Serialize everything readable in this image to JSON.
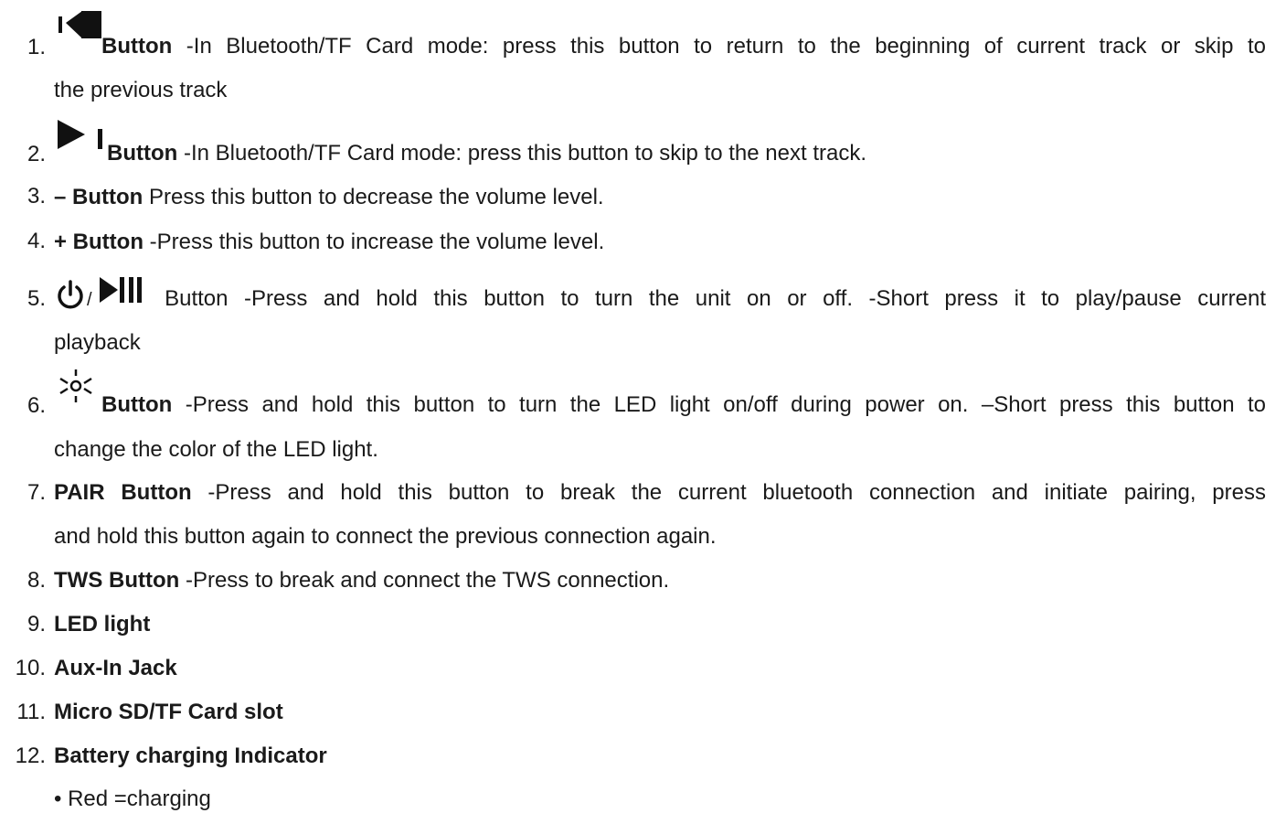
{
  "items": [
    {
      "num": "1.",
      "icon": "previous-track-icon",
      "bold": "Button",
      "text": " -In Bluetooth/TF Card mode: press this button to return to the beginning of current track or skip to",
      "cont": "the previous track"
    },
    {
      "num": "2.",
      "icon": "next-track-icon",
      "bold": "Button",
      "text": " -In Bluetooth/TF Card mode: press this button to skip to the next track."
    },
    {
      "num": "3.",
      "bold": "– Button",
      "text": " Press this button to decrease the volume level."
    },
    {
      "num": "4.",
      "bold": "+ Button",
      "text": " -Press this button to increase the volume level."
    },
    {
      "num": "5.",
      "icon": "power-icon",
      "sep": "/",
      "icon2": "play-pause-icon",
      "text": " Button -Press and hold this button to turn the unit on or off. -Short press it to play/pause current",
      "cont": "playback"
    },
    {
      "num": "6.",
      "icon": "led-light-icon",
      "bold": "Button",
      "text": " -Press and hold this button to turn the LED light on/off during power on. –Short press this button to",
      "cont": "change the color of the LED light."
    },
    {
      "num": "7.",
      "bold": "PAIR Button",
      "text": " -Press and hold this button to break the current bluetooth connection and initiate pairing, press",
      "cont": "and hold this button again to connect the previous connection again."
    },
    {
      "num": "8.",
      "bold": "TWS Button",
      "text": " -Press to break and connect the TWS connection."
    },
    {
      "num": "9.",
      "bold": "LED light"
    },
    {
      "num": "10.",
      "bold": "Aux-In Jack"
    },
    {
      "num": "11.",
      "bold": "Micro SD/TF Card slot"
    },
    {
      "num": "12.",
      "bold": "Battery charging Indicator"
    }
  ],
  "sub_bullet": "• Red =charging"
}
